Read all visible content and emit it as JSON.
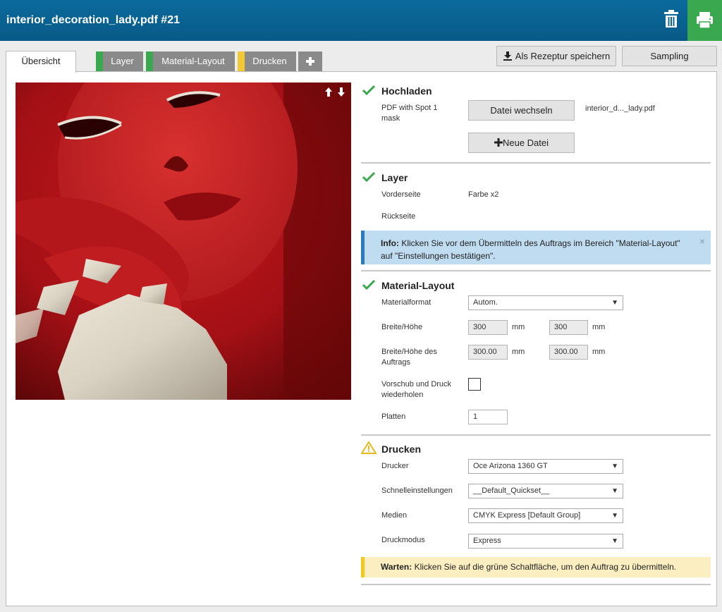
{
  "header": {
    "title": "interior_decoration_lady.pdf #21",
    "trash_icon": "trash-icon",
    "print_icon": "printer-icon",
    "print_color": "#3aa84e",
    "bar_color": "#075a87"
  },
  "tabs": [
    {
      "label": "Übersicht",
      "marker": null,
      "active": true
    },
    {
      "label": "Layer",
      "marker": "#3aa84e",
      "active": false
    },
    {
      "label": "Material-Layout",
      "marker": "#3aa84e",
      "active": false
    },
    {
      "label": "Drucken",
      "marker": "#f2c935",
      "active": false
    }
  ],
  "header_buttons": {
    "save_recipe": "Als Rezeptur speichern",
    "sampling": "Sampling"
  },
  "upload": {
    "title": "Hochladen",
    "file_type": "PDF with Spot 1 mask",
    "change_file": "Datei wechseln",
    "file_name": "interior_d..._lady.pdf",
    "new_file": "Neue Datei"
  },
  "layer": {
    "title": "Layer",
    "front_label": "Vorderseite",
    "front_value": "Farbe x2",
    "back_label": "Rückseite"
  },
  "info_box": {
    "prefix": "Info:",
    "text": " Klicken Sie vor dem Übermitteln des Auftrags im Bereich \"Material-Layout\" auf \"Einstellungen bestätigen\".",
    "close": "×"
  },
  "material": {
    "title": "Material-Layout",
    "format_label": "Materialformat",
    "format_value": "Autom.",
    "size_label": "Breite/Höhe",
    "width": "300",
    "height": "300",
    "unit": "mm",
    "job_size_label": "Breite/Höhe des Auftrags",
    "job_width": "300.00",
    "job_height": "300.00",
    "repeat_label": "Vorschub und Druck wiederholen",
    "repeat_checked": false,
    "plates_label": "Platten",
    "plates_value": "1"
  },
  "print": {
    "title": "Drucken",
    "printer_label": "Drucker",
    "printer_value": "Oce Arizona 1360 GT",
    "quick_label": "Schnelleinstellungen",
    "quick_value": "__Default_Quickset__",
    "media_label": "Medien",
    "media_value": "CMYK Express [Default Group]",
    "mode_label": "Druckmodus",
    "mode_value": "Express"
  },
  "warning": {
    "prefix": "Warten:",
    "text": " Klicken Sie auf die grüne Schaltfläche, um den Auftrag zu übermitteln."
  }
}
